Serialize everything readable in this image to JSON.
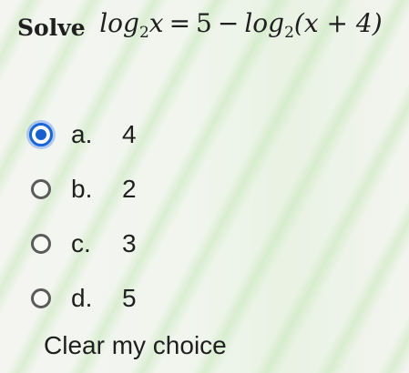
{
  "question": {
    "lead": "Solve",
    "math": {
      "log1": "log",
      "base1": "2",
      "var1": "x",
      "eq": "=",
      "five": "5",
      "minus": "−",
      "log2": "log",
      "base2": "2",
      "paren_arg": "(x + 4)"
    }
  },
  "options": [
    {
      "letter": "a.",
      "value": "4",
      "selected": true
    },
    {
      "letter": "b.",
      "value": "2",
      "selected": false
    },
    {
      "letter": "c.",
      "value": "3",
      "selected": false
    },
    {
      "letter": "d.",
      "value": "5",
      "selected": false
    }
  ],
  "clear_label": "Clear my choice",
  "colors": {
    "accent": "#1a66d6",
    "text": "#1f1f1f"
  }
}
